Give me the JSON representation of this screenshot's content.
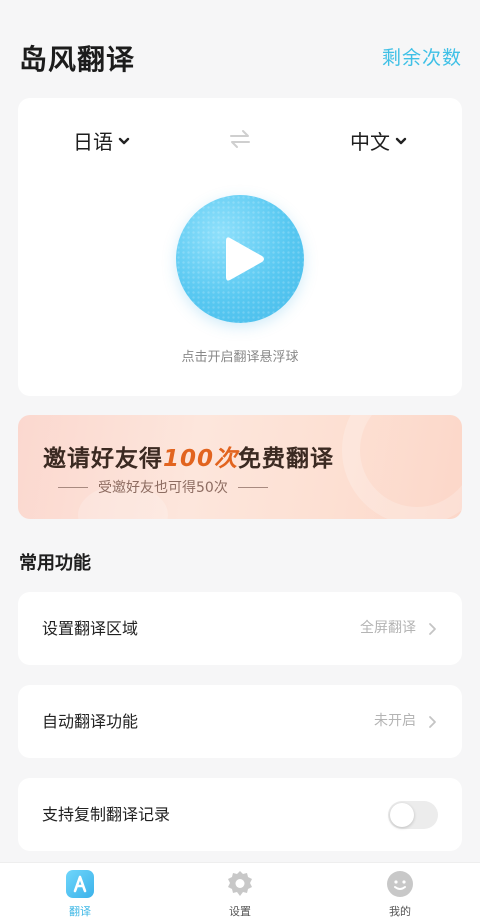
{
  "header": {
    "title": "岛风翻译",
    "remaining_label": "剩余次数"
  },
  "translate": {
    "source_lang": "日语",
    "target_lang": "中文",
    "hint": "点击开启翻译悬浮球"
  },
  "banner": {
    "title_prefix": "邀请好友得",
    "title_highlight": "100次",
    "title_suffix": "免费翻译",
    "subtitle": "受邀好友也可得50次"
  },
  "features": {
    "section_title": "常用功能",
    "items": [
      {
        "label": "设置翻译区域",
        "value": "全屏翻译"
      },
      {
        "label": "自动翻译功能",
        "value": "未开启"
      },
      {
        "label": "支持复制翻译记录",
        "toggle": false
      }
    ]
  },
  "tabbar": {
    "tabs": [
      {
        "label": "翻译",
        "active": true
      },
      {
        "label": "设置",
        "active": false
      },
      {
        "label": "我的",
        "active": false
      }
    ]
  },
  "colors": {
    "accent": "#3fc0e6",
    "highlight": "#e2641f"
  }
}
